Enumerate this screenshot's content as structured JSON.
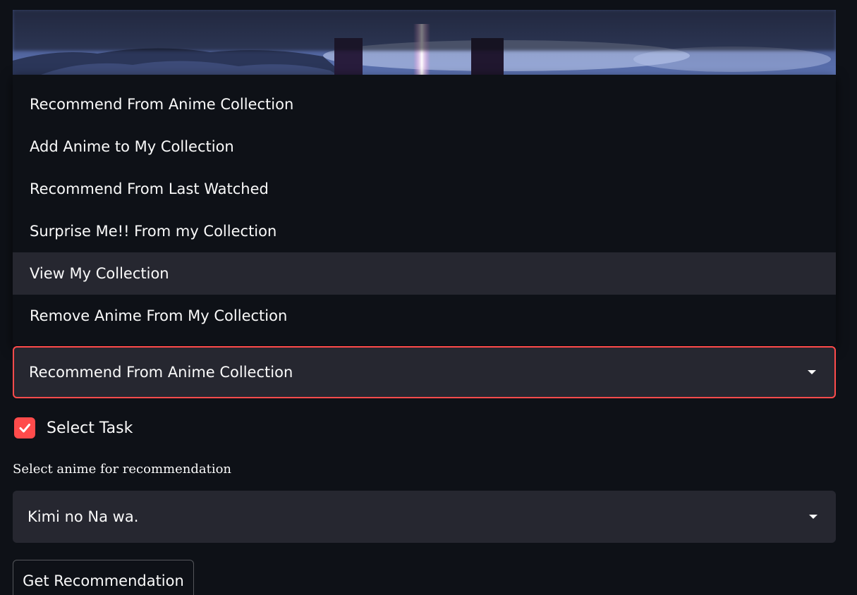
{
  "task_menu": {
    "items": [
      {
        "label": "Recommend From Anime Collection"
      },
      {
        "label": "Add Anime to My Collection"
      },
      {
        "label": "Recommend From Last Watched"
      },
      {
        "label": "Surprise Me!! From my Collection"
      },
      {
        "label": "View My Collection",
        "highlighted": true
      },
      {
        "label": "Remove Anime From My Collection"
      }
    ]
  },
  "task_select": {
    "value": "Recommend From Anime Collection",
    "icon": "chevron-down-icon"
  },
  "select_task_checkbox": {
    "label": "Select Task",
    "checked": true,
    "icon": "check-icon"
  },
  "anime_select": {
    "label": "Select anime for recommendation",
    "value": "Kimi no Na wa.",
    "icon": "chevron-down-icon"
  },
  "recommend_button": {
    "label": "Get Recommendation"
  },
  "colors": {
    "background": "#0e1117",
    "accent": "#ff4b4b",
    "input_bg": "#262730",
    "text": "#fafafa"
  }
}
